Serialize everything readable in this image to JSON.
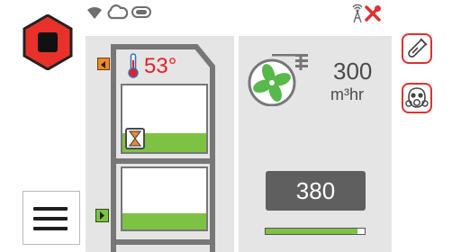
{
  "status_bar": {
    "icons": [
      "wifi-icon",
      "cloud-icon",
      "battery-icon",
      "signal-tower-icon",
      "tools-fault-icon"
    ]
  },
  "controls": {
    "stop_icon": "stop-icon",
    "menu_icon": "hamburger-menu-icon"
  },
  "hood": {
    "temperature": "53°",
    "temperature_icon": "thermometer-icon",
    "upper_sash_arrow": "arrow-left",
    "lower_sash_arrow": "arrow-right",
    "timer_icon": "hourglass-icon",
    "sash_fill_color": "#7dc242",
    "accent_orange": "#f08a24"
  },
  "airflow": {
    "value": "300",
    "unit": "m³hr",
    "fan_color": "#56b94a",
    "speed_setting": "380",
    "speed_level": 0.93
  },
  "right_icons": [
    "flask-sensor-icon",
    "gas-mask-icon"
  ],
  "colors": {
    "alert_red": "#e03030",
    "panel_gray": "#e5e5e5",
    "dark_gray": "#5f5f5f"
  }
}
